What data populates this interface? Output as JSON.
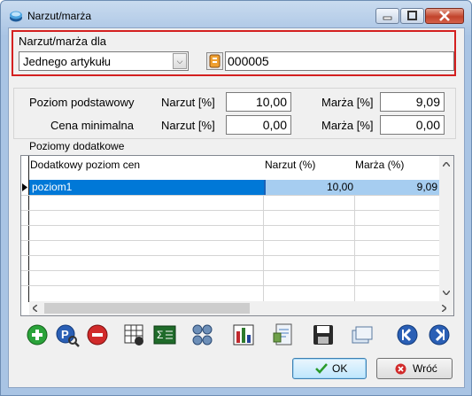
{
  "window": {
    "title": "Narzut/marża"
  },
  "target": {
    "label": "Narzut/marża dla",
    "scope_select_value": "Jednego artykułu",
    "code_value": "000005"
  },
  "base_levels": {
    "row1_label": "Poziom podstawowy",
    "row2_label": "Cena minimalna",
    "narzut_label": "Narzut [%]",
    "marza_label": "Marża [%]",
    "row1_narzut": "10,00",
    "row1_marza": "9,09",
    "row2_narzut": "0,00",
    "row2_marza": "0,00"
  },
  "extra_levels": {
    "section_label": "Poziomy dodatkowe",
    "columns": [
      "Dodatkowy poziom cen",
      "Narzut (%)",
      "Marża (%)"
    ],
    "rows": [
      {
        "name": "poziom1",
        "narzut": "10,00",
        "marza": "9,09"
      }
    ]
  },
  "toolbar": {
    "icons": [
      "add-icon",
      "view-icon",
      "delete-icon",
      "table-search-icon",
      "sum-icon",
      "filter-icon",
      "chart-icon",
      "report-icon",
      "save-icon",
      "copy-icon",
      "previous-icon",
      "next-icon"
    ]
  },
  "buttons": {
    "ok_label": "OK",
    "cancel_label": "Wróć"
  },
  "colors": {
    "selection": "#0078d7",
    "selection_light": "#a6cdf0",
    "highlight_border": "#d42020"
  }
}
